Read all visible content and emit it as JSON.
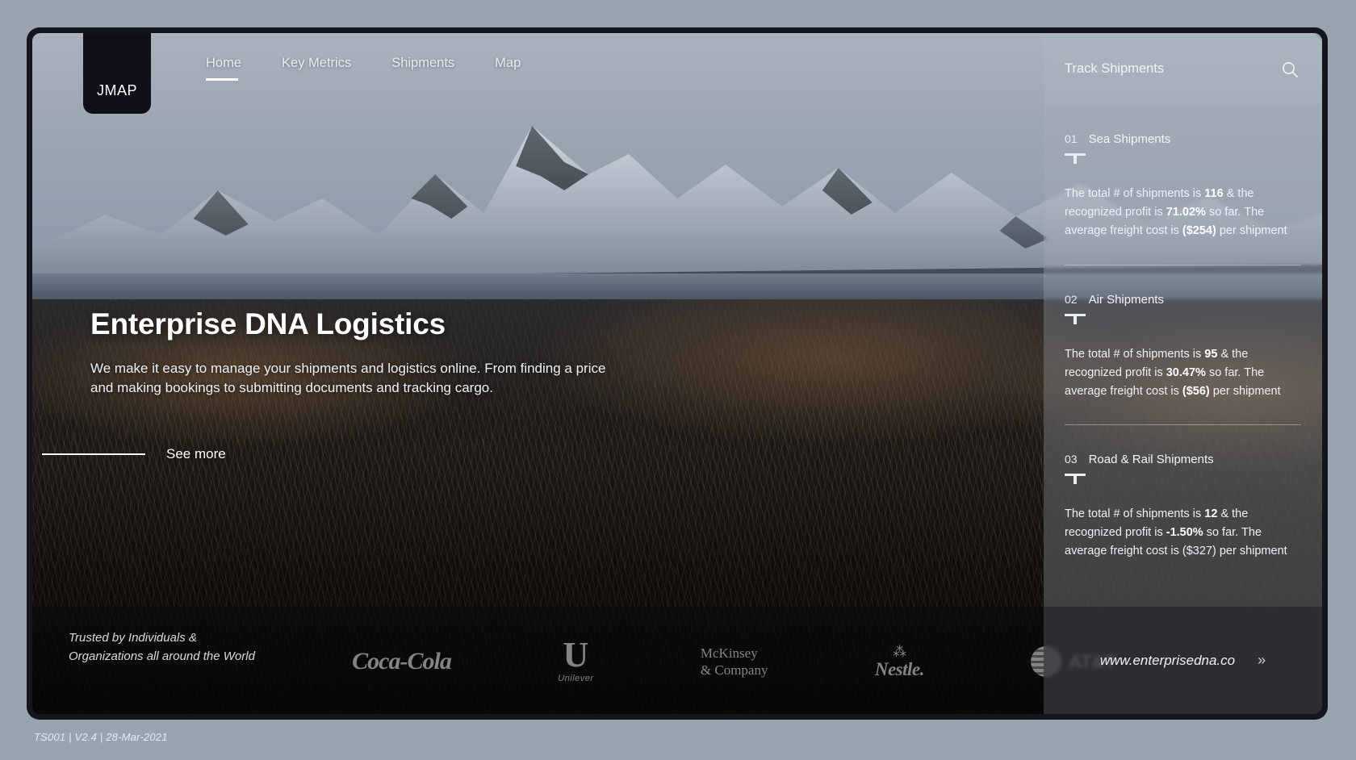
{
  "brand": {
    "logo_text": "JMAP"
  },
  "nav": {
    "items": [
      {
        "label": "Home",
        "active": true
      },
      {
        "label": "Key Metrics",
        "active": false
      },
      {
        "label": "Shipments",
        "active": false
      },
      {
        "label": "Map",
        "active": false
      }
    ]
  },
  "hero": {
    "title": "Enterprise DNA Logistics",
    "subtitle": "We make it easy to manage your shipments and logistics online. From finding a price and making bookings to submitting documents and tracking cargo.",
    "cta_label": "See more"
  },
  "trusted": {
    "caption_line1": "Trusted by Individuals &",
    "caption_line2": "Organizations all around the World",
    "logos": [
      {
        "name": "coca-cola",
        "label": "Coca-Cola"
      },
      {
        "name": "unilever",
        "mark": "U",
        "label": "Unilever"
      },
      {
        "name": "mckinsey",
        "line1": "McKinsey",
        "line2": "& Company"
      },
      {
        "name": "nestle",
        "mark": "⁂",
        "label": "Nestle."
      },
      {
        "name": "att",
        "label": "AT&T"
      }
    ]
  },
  "panel": {
    "title": "Track Shipments",
    "search_icon": "search-icon",
    "shipments": [
      {
        "num": "01",
        "name": "Sea Shipments",
        "glyph": "anchor-icon",
        "desc_pre": "The total # of shipments is ",
        "count": "116",
        "desc_mid": " & the recognized profit  is ",
        "profit": "71.02%",
        "desc_mid2": " so far. The average freight cost is ",
        "cost": "($254)",
        "cost_bold": true,
        "desc_post": " per shipment"
      },
      {
        "num": "02",
        "name": "Air Shipments",
        "glyph": "anchor-icon",
        "desc_pre": "The total # of shipments is ",
        "count": "95",
        "desc_mid": " & the recognized profit  is ",
        "profit": "30.47%",
        "desc_mid2": " so far. The average freight cost is ",
        "cost": "($56)",
        "cost_bold": true,
        "desc_post": " per shipment"
      },
      {
        "num": "03",
        "name": "Road & Rail Shipments",
        "glyph": "anchor-icon",
        "desc_pre": "The total # of shipments is ",
        "count": "12",
        "desc_mid": " & the recognized profit  is ",
        "profit": "-1.50%",
        "desc_mid2": " so far. The average freight cost is ",
        "cost": "($327)",
        "cost_bold": false,
        "desc_post": " per shipment"
      }
    ],
    "footer": {
      "url": "www.enterprisedna.co",
      "chevron": "»"
    }
  },
  "version": "TS001 | V2.4 | 28-Mar-2021",
  "colors": {
    "page_bg": "#99a4b1",
    "frame": "#16141c",
    "accent": "#ffffff",
    "panel_tint": "rgba(168,178,190,0.30)"
  }
}
